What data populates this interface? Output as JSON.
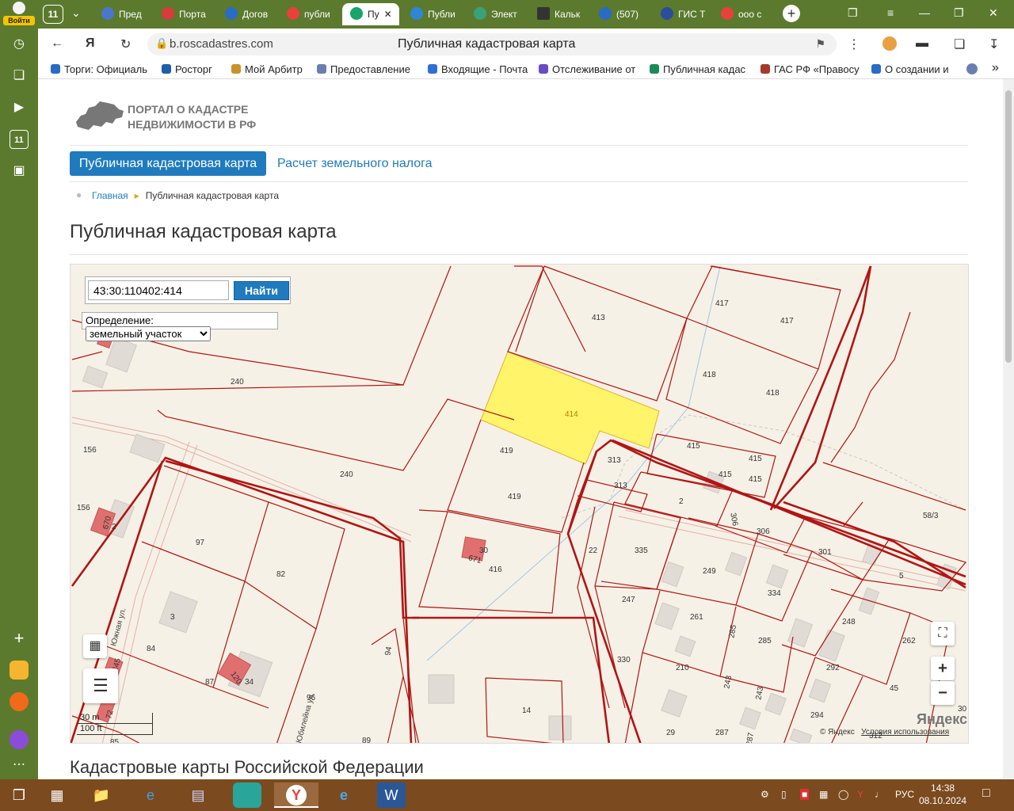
{
  "browser": {
    "login_label": "Войти",
    "tab_counter": "11",
    "tabs": [
      {
        "label": "Пред",
        "color": "#4a77c9"
      },
      {
        "label": "Порта",
        "color": "#d93b3b"
      },
      {
        "label": "Догов",
        "color": "#2a6bc6"
      },
      {
        "label": "публи",
        "color": "#e8413c"
      },
      {
        "label": "Пу",
        "color": "#1aa36a"
      },
      {
        "label": "Публи",
        "color": "#2f86d6"
      },
      {
        "label": "Элект",
        "color": "#3aa17a"
      },
      {
        "label": "Кальк",
        "color": "#333333"
      },
      {
        "label": "(507)",
        "color": "#2a6bc6"
      },
      {
        "label": "ГИС Т",
        "color": "#2a4d9c"
      },
      {
        "label": "ооо с",
        "color": "#e8413c"
      }
    ],
    "url_domain": "b.roscadastres.com",
    "page_title": "Публичная кадастровая карта",
    "bookmarks": [
      {
        "label": "Торги: Официаль",
        "color": "#2a6bc6"
      },
      {
        "label": "Росторг",
        "color": "#1f5fa8"
      },
      {
        "label": "Мой Арбитр",
        "color": "#c9922b"
      },
      {
        "label": "Предоставление",
        "color": "#6a7fb0"
      },
      {
        "label": "Входящие - Почта",
        "color": "#2f6fd6"
      },
      {
        "label": "Отслеживание от",
        "color": "#6a4bc6"
      },
      {
        "label": "Публичная кадас",
        "color": "#1a8a5a"
      },
      {
        "label": "ГАС РФ «Правосу",
        "color": "#a33a2a"
      },
      {
        "label": "О создании и",
        "color": "#2a6bc6"
      }
    ]
  },
  "site": {
    "logo_text_1": "ПОРТАЛ О КАДАСТРЕ",
    "logo_text_2": "НЕДВИЖИМОСТИ В РФ",
    "nav_active": "Публичная кадастровая карта",
    "nav_link": "Расчет земельного налога",
    "breadcrumb_home": "Главная",
    "breadcrumb_current": "Публичная кадастровая карта",
    "heading": "Публичная кадастровая карта",
    "heading_2": "Кадастровые карты Российской Федерации"
  },
  "map": {
    "search_value": "43:30:110402:414",
    "search_button": "Найти",
    "definition_label": "Определение:",
    "definition_value": "земельный участок",
    "scale_m": "30 m",
    "scale_ft": "100 ft",
    "copyright": "© Яндекс",
    "terms": "Условия использования",
    "yandex_logo": "Яндекс",
    "zoom_in": "+",
    "zoom_out": "−",
    "highlight_color": "#fff46a",
    "boundary_color": "#b01515",
    "parcel_labels": [
      "413",
      "417",
      "417",
      "418",
      "418",
      "414",
      "240",
      "240",
      "156",
      "156",
      "419",
      "419",
      "313",
      "313",
      "415",
      "415",
      "415",
      "415",
      "2",
      "306",
      "306",
      "58/3",
      "301",
      "5",
      "97",
      "82",
      "3",
      "416",
      "22",
      "335",
      "249",
      "334",
      "247",
      "261",
      "285",
      "285",
      "248",
      "262",
      "84",
      "87",
      "94",
      "96",
      "89",
      "330",
      "210",
      "292",
      "243",
      "243",
      "45",
      "294",
      "14",
      "29",
      "287",
      "287",
      "312",
      "30",
      "670",
      "671",
      "30",
      "34",
      "120",
      "445",
      "72",
      "85",
      "2",
      "330"
    ],
    "street_labels": [
      "Южная ул.",
      "Юбилейна ул."
    ]
  },
  "taskbar": {
    "lang": "РУС",
    "time": "14:38",
    "date": "08.10.2024"
  }
}
